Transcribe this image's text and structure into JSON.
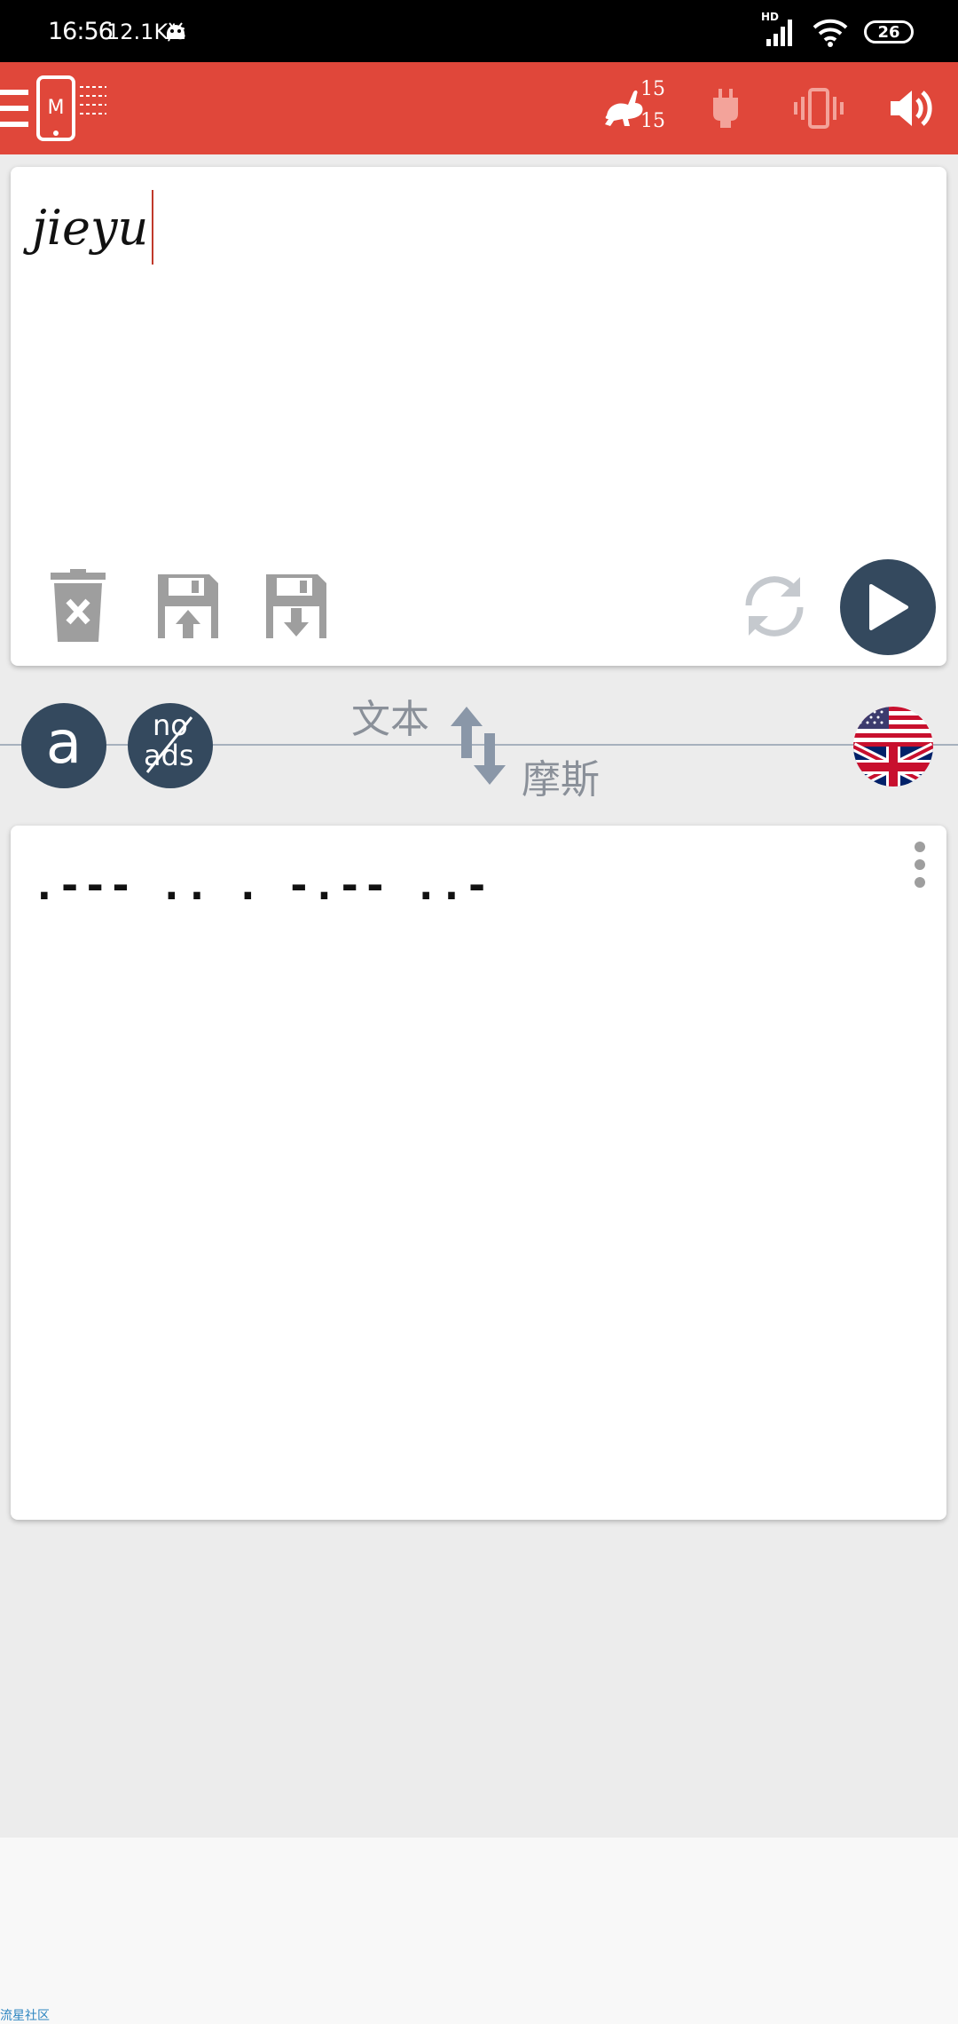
{
  "status_bar": {
    "time": "16:56",
    "net_speed": "12.1K/s",
    "battery": "26",
    "hd_label": "HD"
  },
  "app_bar": {
    "logo_letter": "M",
    "speed_top": "15",
    "speed_bottom": "15"
  },
  "input": {
    "text": "jieyu"
  },
  "mid": {
    "ad_button_letter": "a",
    "no_ads_top": "no",
    "no_ads_bottom": "ads",
    "label_text": "文本",
    "label_morse": "摩斯"
  },
  "output": {
    "morse": ".--- .. . -.-- ..-"
  },
  "footer": {
    "label": "流星社区"
  },
  "colors": {
    "app_bar": "#e0473a",
    "dark_button": "#34495e",
    "icon_gray": "#9e9e9e"
  }
}
